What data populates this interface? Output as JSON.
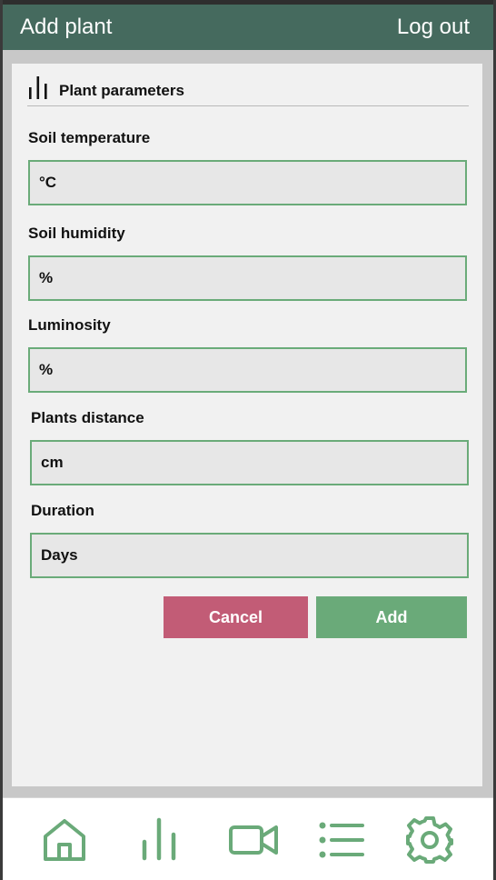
{
  "header": {
    "title": "Add plant",
    "logout_label": "Log out"
  },
  "section": {
    "title": "Plant parameters",
    "icon": "bar-chart-icon"
  },
  "fields": [
    {
      "label": "Soil temperature",
      "placeholder": "°C"
    },
    {
      "label": "Soil humidity",
      "placeholder": "%"
    },
    {
      "label": "Luminosity",
      "placeholder": "%"
    },
    {
      "label": "Plants distance",
      "placeholder": "cm"
    },
    {
      "label": "Duration",
      "placeholder": "Days"
    }
  ],
  "buttons": {
    "cancel_label": "Cancel",
    "add_label": "Add"
  },
  "nav": [
    "home-icon",
    "bar-chart-icon",
    "video-camera-icon",
    "list-icon",
    "gear-icon"
  ],
  "colors": {
    "header_bg": "#456a5e",
    "accent_green": "#6aaa79",
    "cancel_pink": "#c25c76",
    "card_bg": "#f1f1f1"
  }
}
